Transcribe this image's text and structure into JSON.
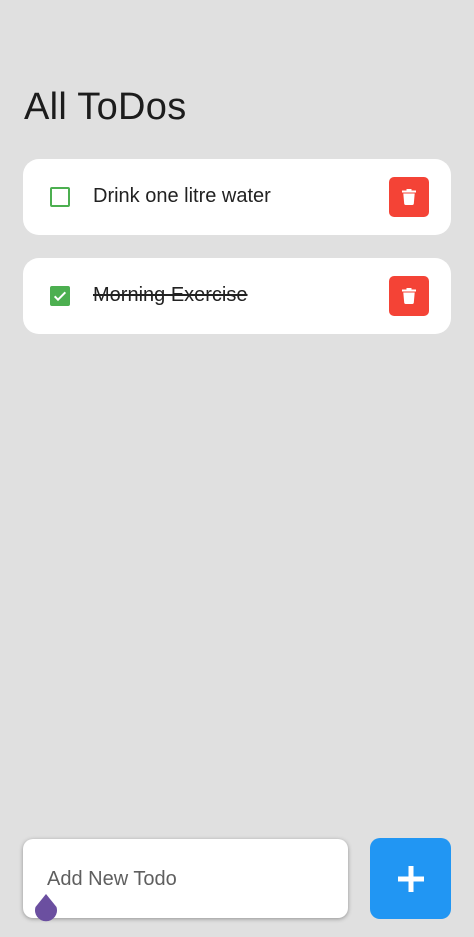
{
  "header": {
    "title": "All ToDos"
  },
  "todos": [
    {
      "text": "Drink one litre water",
      "completed": false
    },
    {
      "text": "Morning Exercise",
      "completed": true
    }
  ],
  "icons": {
    "checkbox": "check-icon",
    "delete": "trash-icon",
    "add": "plus-icon"
  },
  "new_todo": {
    "placeholder": "Add New Todo",
    "value": ""
  },
  "colors": {
    "background": "#e0e0e0",
    "card": "#ffffff",
    "checkbox": "#4caf50",
    "delete": "#f44336",
    "add": "#2196f3",
    "cursor_handle": "#6b4fa0"
  }
}
